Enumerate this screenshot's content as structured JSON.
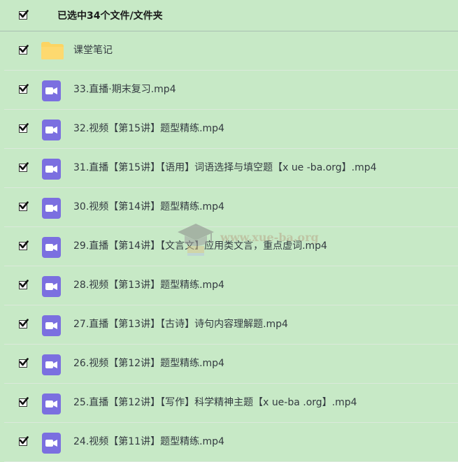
{
  "header": {
    "checked": true,
    "title": "已选中34个文件/文件夹"
  },
  "files": [
    {
      "type": "folder",
      "name": "课堂笔记",
      "checked": true,
      "icon": "folder-icon"
    },
    {
      "type": "video",
      "name": "33.直播·期末复习.mp4",
      "checked": true,
      "icon": "video-icon"
    },
    {
      "type": "video",
      "name": "32.视频【第15讲】题型精练.mp4",
      "checked": true,
      "icon": "video-icon"
    },
    {
      "type": "video",
      "name": "31.直播【第15讲】【语用】词语选择与填空题【x ue -ba.org】.mp4",
      "checked": true,
      "icon": "video-icon"
    },
    {
      "type": "video",
      "name": "30.视频【第14讲】题型精练.mp4",
      "checked": true,
      "icon": "video-icon"
    },
    {
      "type": "video",
      "name": "29.直播【第14讲】【文言文】应用类文言，重点虚词.mp4",
      "checked": true,
      "icon": "video-icon"
    },
    {
      "type": "video",
      "name": "28.视频【第13讲】题型精练.mp4",
      "checked": true,
      "icon": "video-icon"
    },
    {
      "type": "video",
      "name": "27.直播【第13讲】【古诗】诗句内容理解题.mp4",
      "checked": true,
      "icon": "video-icon"
    },
    {
      "type": "video",
      "name": "26.视频【第12讲】题型精练.mp4",
      "checked": true,
      "icon": "video-icon"
    },
    {
      "type": "video",
      "name": "25.直播【第12讲】【写作】科学精神主题【x ue-ba .org】.mp4",
      "checked": true,
      "icon": "video-icon"
    },
    {
      "type": "video",
      "name": "24.视频【第11讲】题型精练.mp4",
      "checked": true,
      "icon": "video-icon"
    }
  ],
  "watermark": {
    "text": "www.xue-ba.org"
  },
  "colors": {
    "background": "#c7e9c6",
    "video_icon": "#7b6fe0",
    "folder_icon": "#fcd462"
  }
}
